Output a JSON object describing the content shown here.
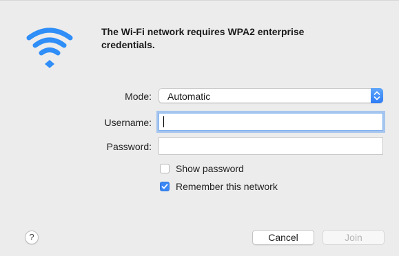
{
  "dialog": {
    "heading": "The Wi-Fi network requires WPA2 enterprise credentials."
  },
  "form": {
    "mode_label": "Mode:",
    "mode_value": "Automatic",
    "username_label": "Username:",
    "username_value": "",
    "password_label": "Password:",
    "password_value": ""
  },
  "options": {
    "show_password_label": "Show password",
    "show_password_checked": false,
    "remember_label": "Remember this network",
    "remember_checked": true
  },
  "buttons": {
    "help_label": "?",
    "cancel_label": "Cancel",
    "join_label": "Join",
    "join_enabled": false
  },
  "icons": {
    "wifi": "wifi-icon",
    "stepper": "chevron-up-down-icon",
    "check": "checkmark-icon"
  },
  "colors": {
    "accent": "#3b87f5",
    "wifi": "#2f8ef7",
    "dialog_bg": "#ececec"
  }
}
